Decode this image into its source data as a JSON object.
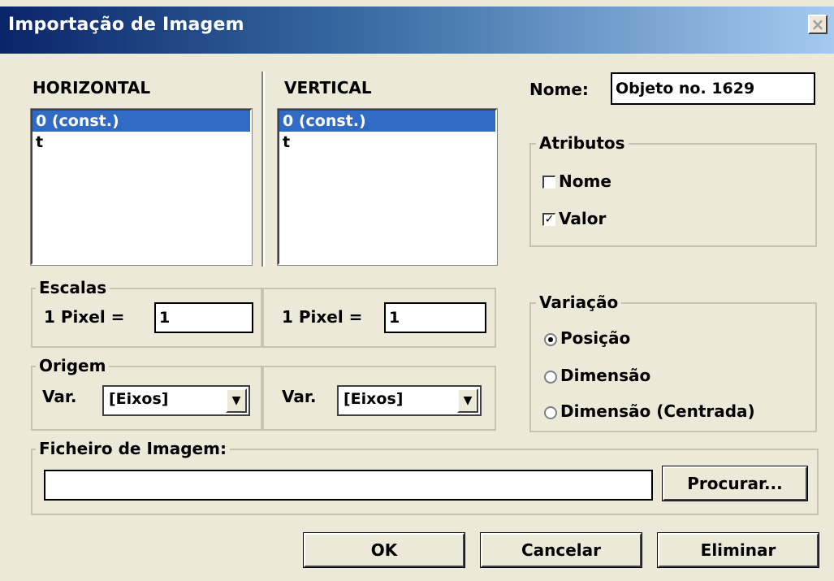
{
  "window": {
    "title": "Importação de Imagem",
    "close_glyph": "×"
  },
  "horizontal": {
    "heading": "HORIZONTAL",
    "items": [
      "0 (const.)",
      "t"
    ],
    "selected_index": 0
  },
  "vertical": {
    "heading": "VERTICAL",
    "items": [
      "0 (const.)",
      "t"
    ],
    "selected_index": 0
  },
  "name": {
    "label": "Nome:",
    "value": "Objeto no. 1629"
  },
  "attributes": {
    "title": "Atributos",
    "items": [
      {
        "label": "Nome",
        "checked": false
      },
      {
        "label": "Valor",
        "checked": true
      }
    ]
  },
  "scales": {
    "title": "Escalas",
    "horizontal": {
      "label": "1 Pixel =",
      "value": "1"
    },
    "vertical": {
      "label": "1 Pixel =",
      "value": "1"
    }
  },
  "origin": {
    "title": "Origem",
    "horizontal": {
      "label": "Var.",
      "value": "[Eixos]"
    },
    "vertical": {
      "label": "Var.",
      "value": "[Eixos]"
    }
  },
  "variation": {
    "title": "Variação",
    "options": [
      "Posição",
      "Dimensão",
      "Dimensão (Centrada)"
    ],
    "selected_index": 0
  },
  "image_file": {
    "title": "Ficheiro de Imagem:",
    "value": "",
    "browse_label": "Procurar..."
  },
  "buttons": {
    "ok": "OK",
    "cancel": "Cancelar",
    "delete": "Eliminar"
  },
  "icons": {
    "close": "close-icon",
    "dropdown": "chevron-down-icon",
    "check": "checkmark-icon"
  },
  "colors": {
    "selection": "#316ac5",
    "titlebar_start": "#0a246a",
    "titlebar_end": "#a6caf0",
    "dialog_bg": "#ece9d8"
  }
}
